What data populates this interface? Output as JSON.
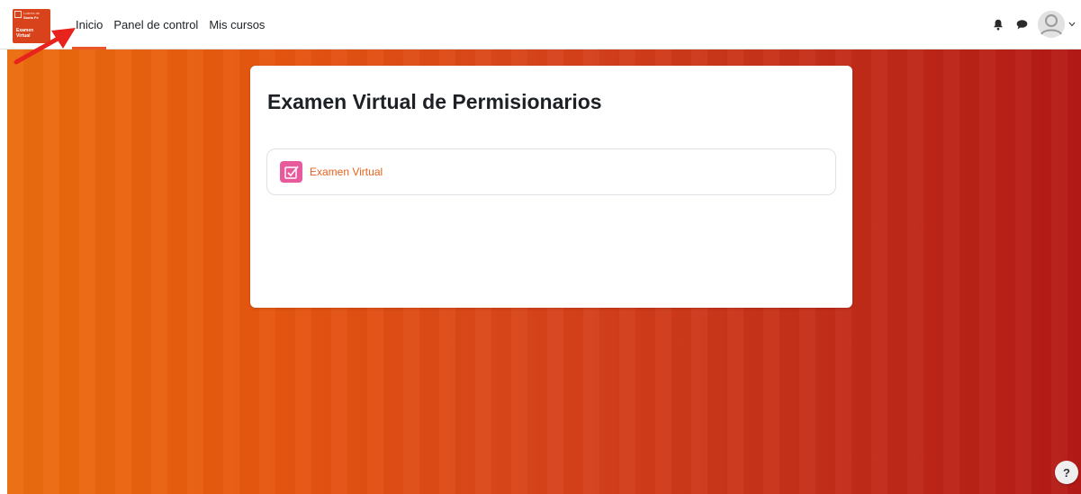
{
  "logo": {
    "brand_line1": "Lotería de",
    "brand_line2": "Santa Fe",
    "product_line1": "Examen",
    "product_line2": "Virtual"
  },
  "nav": {
    "items": [
      {
        "label": "Inicio",
        "active": true
      },
      {
        "label": "Panel de control",
        "active": false
      },
      {
        "label": "Mis cursos",
        "active": false
      }
    ]
  },
  "header_icons": {
    "notifications": "bell-icon",
    "messages": "chat-bubble-icon",
    "user_menu": "avatar",
    "menu_caret": "chevron-down-icon"
  },
  "course": {
    "title": "Examen Virtual de Permisionarios",
    "activities": [
      {
        "name": "Examen Virtual",
        "icon": "quiz-icon"
      }
    ]
  },
  "help": {
    "label": "?"
  },
  "colors": {
    "accent": "#e8562a",
    "activity_link": "#e8621f",
    "quiz_icon": "#e75a9c",
    "gradient_start": "#ec6d0e",
    "gradient_end": "#b41a16",
    "annotation_arrow": "#e8231e"
  }
}
